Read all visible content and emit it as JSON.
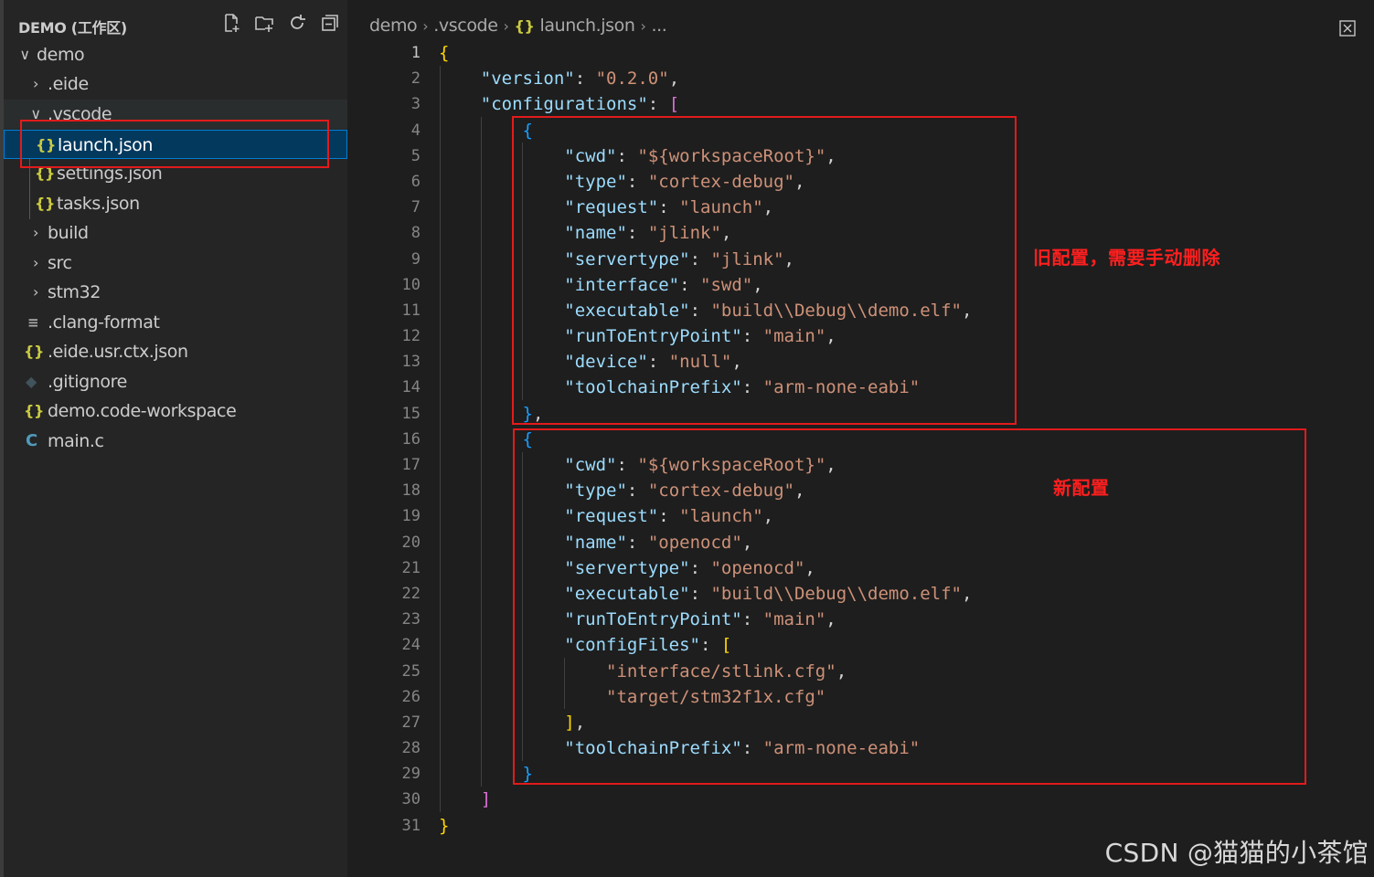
{
  "explorer": {
    "title": "DEMO (工作区)",
    "actions": [
      "new-file-icon",
      "new-folder-icon",
      "refresh-icon",
      "collapse-all-icon"
    ],
    "tree": [
      {
        "label": "demo",
        "chevron": "∨"
      },
      {
        "label": ".eide",
        "chevron": "›"
      },
      {
        "label": ".vscode",
        "chevron": "∨"
      },
      {
        "label": "launch.json",
        "icon": "{}"
      },
      {
        "label": "settings.json",
        "icon": "{}"
      },
      {
        "label": "tasks.json",
        "icon": "{}"
      },
      {
        "label": "build",
        "chevron": "›"
      },
      {
        "label": "src",
        "chevron": "›"
      },
      {
        "label": "stm32",
        "chevron": "›"
      },
      {
        "label": ".clang-format",
        "icon": "≡"
      },
      {
        "label": ".eide.usr.ctx.json",
        "icon": "{}"
      },
      {
        "label": ".gitignore",
        "icon": "◆"
      },
      {
        "label": "demo.code-workspace",
        "icon": "{}"
      },
      {
        "label": "main.c",
        "icon": "C"
      }
    ]
  },
  "breadcrumb": {
    "items": [
      "demo",
      ".vscode",
      "launch.json",
      "..."
    ],
    "sep": "›",
    "json_icon": "{}"
  },
  "editor": {
    "line_numbers": [
      "1",
      "2",
      "3",
      "4",
      "5",
      "6",
      "7",
      "8",
      "9",
      "10",
      "11",
      "12",
      "13",
      "14",
      "15",
      "16",
      "17",
      "18",
      "19",
      "20",
      "21",
      "22",
      "23",
      "24",
      "25",
      "26",
      "27",
      "28",
      "29",
      "30",
      "31"
    ],
    "lines": [
      [
        {
          "t": "{",
          "c": "b1"
        }
      ],
      [
        {
          "t": "    "
        },
        {
          "t": "\"version\"",
          "c": "k"
        },
        {
          "t": ": ",
          "c": "p"
        },
        {
          "t": "\"0.2.0\"",
          "c": "s"
        },
        {
          "t": ",",
          "c": "p"
        }
      ],
      [
        {
          "t": "    "
        },
        {
          "t": "\"configurations\"",
          "c": "k"
        },
        {
          "t": ": ",
          "c": "p"
        },
        {
          "t": "[",
          "c": "b2"
        }
      ],
      [
        {
          "t": "        "
        },
        {
          "t": "{",
          "c": "b3"
        }
      ],
      [
        {
          "t": "            "
        },
        {
          "t": "\"cwd\"",
          "c": "k"
        },
        {
          "t": ": ",
          "c": "p"
        },
        {
          "t": "\"${workspaceRoot}\"",
          "c": "s"
        },
        {
          "t": ",",
          "c": "p"
        }
      ],
      [
        {
          "t": "            "
        },
        {
          "t": "\"type\"",
          "c": "k"
        },
        {
          "t": ": ",
          "c": "p"
        },
        {
          "t": "\"cortex-debug\"",
          "c": "s"
        },
        {
          "t": ",",
          "c": "p"
        }
      ],
      [
        {
          "t": "            "
        },
        {
          "t": "\"request\"",
          "c": "k"
        },
        {
          "t": ": ",
          "c": "p"
        },
        {
          "t": "\"launch\"",
          "c": "s"
        },
        {
          "t": ",",
          "c": "p"
        }
      ],
      [
        {
          "t": "            "
        },
        {
          "t": "\"name\"",
          "c": "k"
        },
        {
          "t": ": ",
          "c": "p"
        },
        {
          "t": "\"jlink\"",
          "c": "s"
        },
        {
          "t": ",",
          "c": "p"
        }
      ],
      [
        {
          "t": "            "
        },
        {
          "t": "\"servertype\"",
          "c": "k"
        },
        {
          "t": ": ",
          "c": "p"
        },
        {
          "t": "\"jlink\"",
          "c": "s"
        },
        {
          "t": ",",
          "c": "p"
        }
      ],
      [
        {
          "t": "            "
        },
        {
          "t": "\"interface\"",
          "c": "k"
        },
        {
          "t": ": ",
          "c": "p"
        },
        {
          "t": "\"swd\"",
          "c": "s"
        },
        {
          "t": ",",
          "c": "p"
        }
      ],
      [
        {
          "t": "            "
        },
        {
          "t": "\"executable\"",
          "c": "k"
        },
        {
          "t": ": ",
          "c": "p"
        },
        {
          "t": "\"build\\\\Debug\\\\demo.elf\"",
          "c": "s"
        },
        {
          "t": ",",
          "c": "p"
        }
      ],
      [
        {
          "t": "            "
        },
        {
          "t": "\"runToEntryPoint\"",
          "c": "k"
        },
        {
          "t": ": ",
          "c": "p"
        },
        {
          "t": "\"main\"",
          "c": "s"
        },
        {
          "t": ",",
          "c": "p"
        }
      ],
      [
        {
          "t": "            "
        },
        {
          "t": "\"device\"",
          "c": "k"
        },
        {
          "t": ": ",
          "c": "p"
        },
        {
          "t": "\"null\"",
          "c": "s"
        },
        {
          "t": ",",
          "c": "p"
        }
      ],
      [
        {
          "t": "            "
        },
        {
          "t": "\"toolchainPrefix\"",
          "c": "k"
        },
        {
          "t": ": ",
          "c": "p"
        },
        {
          "t": "\"arm-none-eabi\"",
          "c": "s"
        }
      ],
      [
        {
          "t": "        "
        },
        {
          "t": "}",
          "c": "b3"
        },
        {
          "t": ",",
          "c": "p"
        }
      ],
      [
        {
          "t": "        "
        },
        {
          "t": "{",
          "c": "b3"
        }
      ],
      [
        {
          "t": "            "
        },
        {
          "t": "\"cwd\"",
          "c": "k"
        },
        {
          "t": ": ",
          "c": "p"
        },
        {
          "t": "\"${workspaceRoot}\"",
          "c": "s"
        },
        {
          "t": ",",
          "c": "p"
        }
      ],
      [
        {
          "t": "            "
        },
        {
          "t": "\"type\"",
          "c": "k"
        },
        {
          "t": ": ",
          "c": "p"
        },
        {
          "t": "\"cortex-debug\"",
          "c": "s"
        },
        {
          "t": ",",
          "c": "p"
        }
      ],
      [
        {
          "t": "            "
        },
        {
          "t": "\"request\"",
          "c": "k"
        },
        {
          "t": ": ",
          "c": "p"
        },
        {
          "t": "\"launch\"",
          "c": "s"
        },
        {
          "t": ",",
          "c": "p"
        }
      ],
      [
        {
          "t": "            "
        },
        {
          "t": "\"name\"",
          "c": "k"
        },
        {
          "t": ": ",
          "c": "p"
        },
        {
          "t": "\"openocd\"",
          "c": "s"
        },
        {
          "t": ",",
          "c": "p"
        }
      ],
      [
        {
          "t": "            "
        },
        {
          "t": "\"servertype\"",
          "c": "k"
        },
        {
          "t": ": ",
          "c": "p"
        },
        {
          "t": "\"openocd\"",
          "c": "s"
        },
        {
          "t": ",",
          "c": "p"
        }
      ],
      [
        {
          "t": "            "
        },
        {
          "t": "\"executable\"",
          "c": "k"
        },
        {
          "t": ": ",
          "c": "p"
        },
        {
          "t": "\"build\\\\Debug\\\\demo.elf\"",
          "c": "s"
        },
        {
          "t": ",",
          "c": "p"
        }
      ],
      [
        {
          "t": "            "
        },
        {
          "t": "\"runToEntryPoint\"",
          "c": "k"
        },
        {
          "t": ": ",
          "c": "p"
        },
        {
          "t": "\"main\"",
          "c": "s"
        },
        {
          "t": ",",
          "c": "p"
        }
      ],
      [
        {
          "t": "            "
        },
        {
          "t": "\"configFiles\"",
          "c": "k"
        },
        {
          "t": ": ",
          "c": "p"
        },
        {
          "t": "[",
          "c": "b1"
        }
      ],
      [
        {
          "t": "                "
        },
        {
          "t": "\"interface/stlink.cfg\"",
          "c": "s"
        },
        {
          "t": ",",
          "c": "p"
        }
      ],
      [
        {
          "t": "                "
        },
        {
          "t": "\"target/stm32f1x.cfg\"",
          "c": "s"
        }
      ],
      [
        {
          "t": "            "
        },
        {
          "t": "]",
          "c": "b1"
        },
        {
          "t": ",",
          "c": "p"
        }
      ],
      [
        {
          "t": "            "
        },
        {
          "t": "\"toolchainPrefix\"",
          "c": "k"
        },
        {
          "t": ": ",
          "c": "p"
        },
        {
          "t": "\"arm-none-eabi\"",
          "c": "s"
        }
      ],
      [
        {
          "t": "        "
        },
        {
          "t": "}",
          "c": "b3"
        }
      ],
      [
        {
          "t": "    "
        },
        {
          "t": "]",
          "c": "b2"
        }
      ],
      [
        {
          "t": "}",
          "c": "b1"
        }
      ]
    ]
  },
  "annotations": {
    "old_config": "旧配置，需要手动删除",
    "new_config": "新配置"
  },
  "watermark": "CSDN @猫猫的小茶馆",
  "colors": {
    "key": "#9cdcfe",
    "string": "#ce9178",
    "annotation_red": "#e21b1b",
    "selection": "#04395e"
  }
}
